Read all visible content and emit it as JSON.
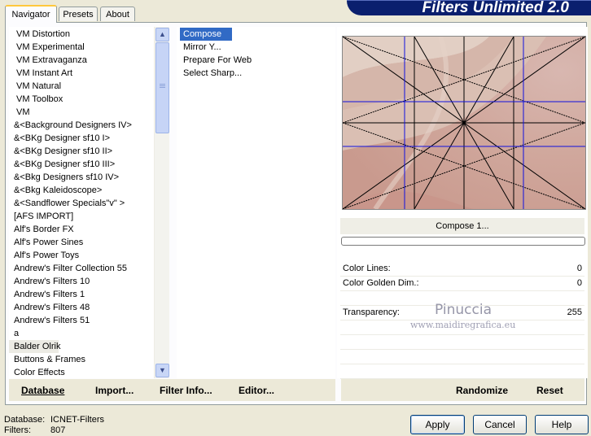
{
  "banner": {
    "title": "Filters Unlimited 2.0"
  },
  "tabs": [
    "Navigator",
    "Presets",
    "About"
  ],
  "categories": [
    "VM Distortion",
    "VM Experimental",
    "VM Extravaganza",
    "VM Instant Art",
    "VM Natural",
    "VM Toolbox",
    "VM",
    "&<Background Designers IV>",
    "&<BKg Designer sf10 I>",
    "&<BKg Designer sf10 II>",
    "&<BKg Designer sf10 III>",
    "&<Bkg Designers sf10 IV>",
    "&<Bkg Kaleidoscope>",
    "&<Sandflower Specials\"v\" >",
    "[AFS IMPORT]",
    "Alf's Border FX",
    "Alf's Power Sines",
    "Alf's Power Toys",
    "Andrew's Filter Collection 55",
    "Andrew's Filters 10",
    "Andrew's Filters 1",
    "Andrew's Filters 48",
    "Andrew's Filters 51",
    "a",
    "Balder Olrik",
    "Buttons & Frames",
    "Color Effects"
  ],
  "selected_category": "Balder Olrik",
  "filters": [
    "Compose 1...",
    "Mirror Y...",
    "Prepare For Web",
    "Select Sharp..."
  ],
  "selected_filter": "Compose 1...",
  "preview_name": "Compose 1...",
  "progress": 0,
  "params": {
    "color_lines": {
      "label": "Color Lines:",
      "value": "0"
    },
    "color_golden": {
      "label": "Color Golden Dim.:",
      "value": "0"
    },
    "transparency": {
      "label": "Transparency:",
      "value": "255"
    }
  },
  "watermark": {
    "name": "Pinuccia",
    "site": "www.maidiregrafica.eu"
  },
  "left_actions": [
    "Database",
    "Import...",
    "Filter Info...",
    "Editor..."
  ],
  "right_actions": [
    "Randomize",
    "Reset"
  ],
  "status": {
    "database_label": "Database:",
    "database_value": "ICNET-Filters",
    "filters_label": "Filters:",
    "filters_value": "807"
  },
  "dialog_buttons": {
    "apply": "Apply",
    "cancel": "Cancel",
    "help": "Help"
  },
  "colors": {
    "accent": "#0A1F6E",
    "selection": "#316AC5",
    "guide_blue": "#0000FF"
  }
}
